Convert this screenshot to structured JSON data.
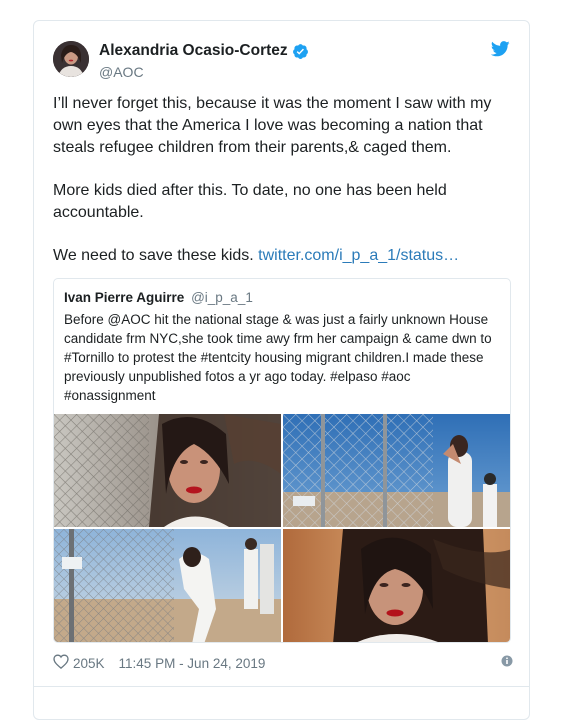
{
  "author": {
    "name": "Alexandria Ocasio-Cortez",
    "handle": "@AOC"
  },
  "tweet": {
    "paragraph1": "I’ll never forget this, because it was the moment I saw with my own eyes that the America I love was becoming a nation that steals refugee children from their parents,& caged them.",
    "paragraph2": "More kids died after this. To date, no one has been held accountable.",
    "paragraph3_text": "We need to save these kids. ",
    "paragraph3_link": "twitter.com/i_p_a_1/status…"
  },
  "quoted": {
    "name": "Ivan Pierre Aguirre",
    "handle": "@i_p_a_1",
    "text": "Before @AOC hit the national stage & was just a fairly unknown House candidate frm NYC,she took time awy frm her campaign & came dwn to #Tornillo to protest the #tentcity housing migrant children.I made these previously unpublished fotos a yr ago today. #elpaso #aoc #onassignment"
  },
  "footer": {
    "likes": "205K",
    "timestamp": "11:45 PM - Jun 24, 2019"
  },
  "colors": {
    "link": "#2b7bb9",
    "verified": "#1da1f2",
    "muted": "#697882",
    "border": "#e1e8ed"
  },
  "icons": [
    "verified-badge-icon",
    "twitter-bird-icon",
    "heart-icon",
    "info-icon"
  ]
}
